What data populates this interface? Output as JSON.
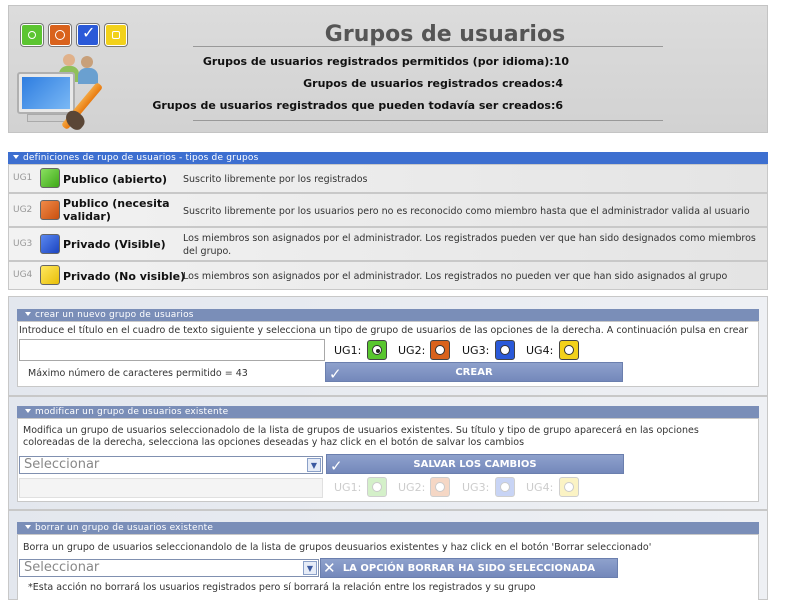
{
  "header": {
    "title": "Grupos de usuarios",
    "stats": [
      {
        "label": "Grupos de usuarios registrados permitidos (por idioma)",
        "value": "10"
      },
      {
        "label": "Grupos de usuarios registrados creados",
        "value": "4"
      },
      {
        "label": "Grupos de usuarios registrados que pueden todavía ser creados",
        "value": "6"
      }
    ]
  },
  "definitions": {
    "title": "definiciones de rupo de usuarios - tipos de grupos",
    "groups": [
      {
        "code": "UG1",
        "name": "Publico (abierto)",
        "desc": "Suscrito libremente por los registrados",
        "color": "#5cc531"
      },
      {
        "code": "UG2",
        "name": "Publico (necesita validar)",
        "desc": "Suscrito libremente por los usuarios pero no es reconocido como miembro hasta que el administrador valida al usuario",
        "color": "#d9621c"
      },
      {
        "code": "UG3",
        "name": "Privado (Visible)",
        "desc": "Los miembros son asignados por el administrador. Los registrados pueden ver que han sido designados como miembros del grupo.",
        "color": "#2a59d8"
      },
      {
        "code": "UG4",
        "name": "Privado (No visible)",
        "desc": "Los miembros son asignados por el administrador. Los registrados no pueden ver que han sido asignados al grupo",
        "color": "#f2d11a"
      }
    ]
  },
  "create": {
    "title": "crear un nuevo grupo de usuarios",
    "instructions": "Introduce el título en el cuadro de texto siguiente y selecciona un tipo de grupo de usuarios de las opciones de la derecha. A continuación pulsa en crear",
    "max_chars": "Máximo número de caracteres permitido = 43",
    "options": [
      "UG1:",
      "UG2:",
      "UG3:",
      "UG4:"
    ],
    "selected_index": 0,
    "button": "CREAR"
  },
  "modify": {
    "title": "modificar un grupo de usuarios existente",
    "instructions": "Modifica un grupo de usuarios seleccionadolo de la lista de grupos de usuarios existentes. Su título y tipo de grupo aparecerá en las opciones coloreadas de la derecha, selecciona las opciones deseadas y haz click en el botón de salvar los cambios",
    "select_value": "Seleccionar",
    "button": "SALVAR LOS CAMBIOS",
    "options": [
      "UG1:",
      "UG2:",
      "UG3:",
      "UG4:"
    ]
  },
  "delete": {
    "title": "borrar un grupo de usuarios existente",
    "instructions": "Borra un grupo de usuarios seleccionandolo de la lista de grupos deusuarios existentes y haz click en el botón 'Borrar seleccionado'",
    "select_value": "Seleccionar",
    "button": "LA OPCIÓN BORRAR HA SIDO SELECCIONADA",
    "note": "*Esta acción no borrará los usuarios registrados pero sí borrará la relación entre los registrados y su grupo"
  }
}
